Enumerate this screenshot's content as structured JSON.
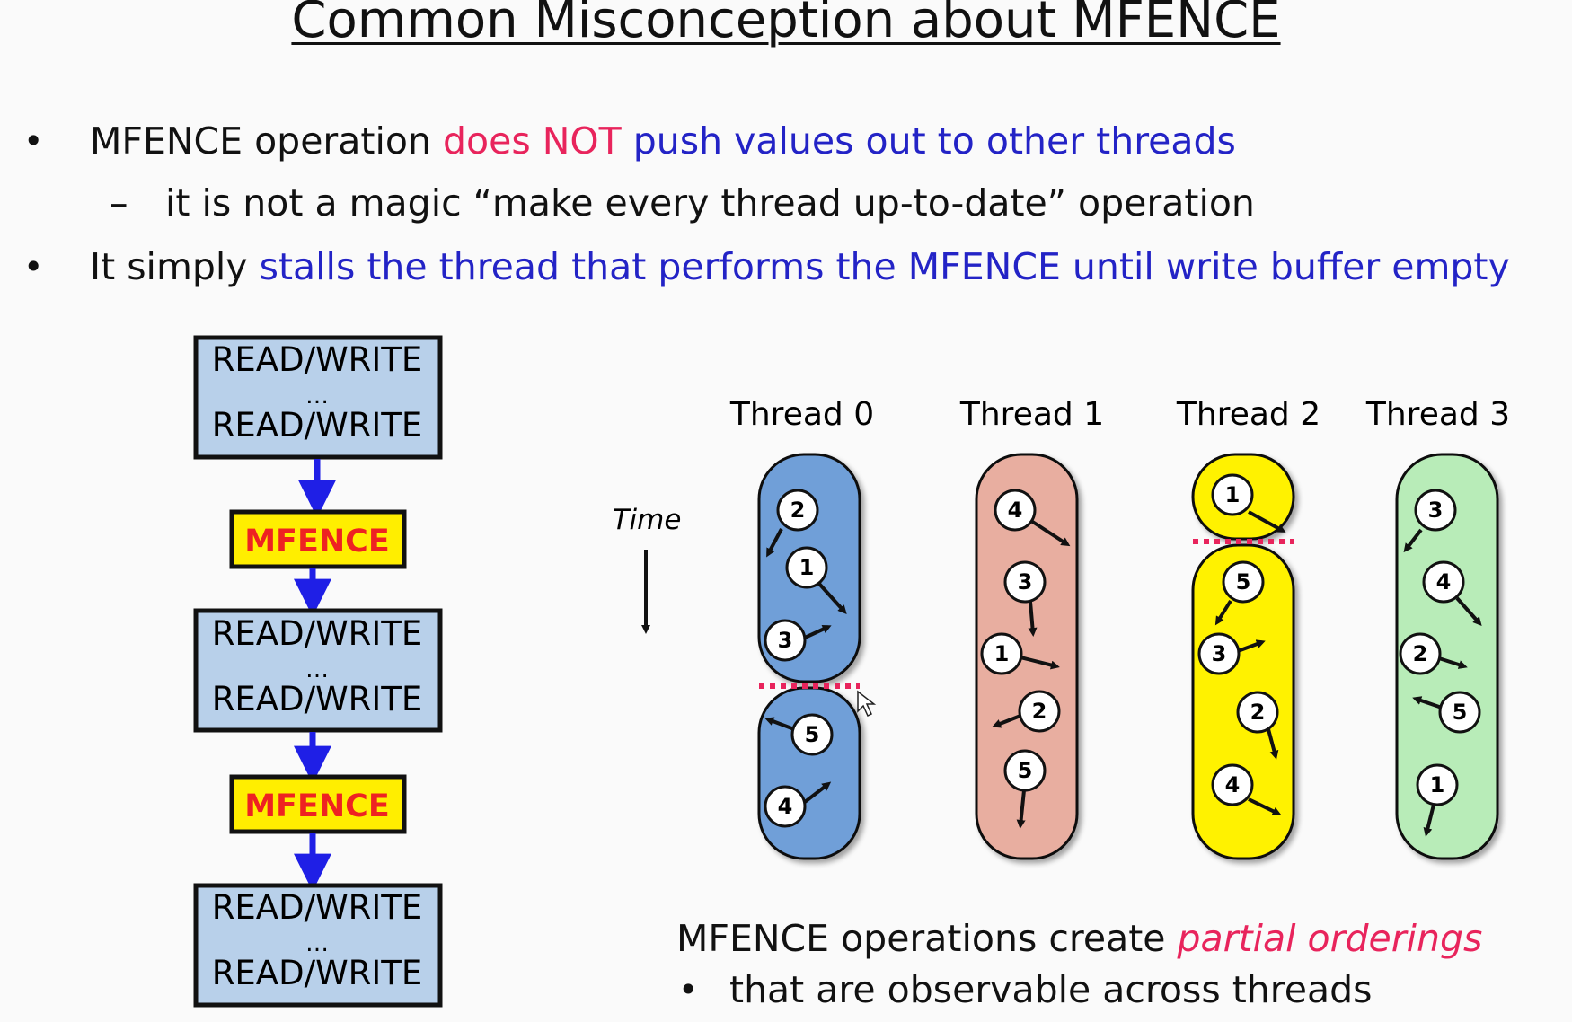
{
  "title": "Common Misconception about MFENCE",
  "bullets": {
    "b1": {
      "p1": "MFENCE operation ",
      "p2": "does NOT",
      "p3": " push values out to other threads"
    },
    "sub1": "it is not a magic “make every thread up-to-date” operation",
    "b2": {
      "p1": "It simply ",
      "p2": "stalls the thread that performs the MFENCE until write buffer empty"
    }
  },
  "left_flow": {
    "block_top": "READ/WRITE",
    "block_ellipsis": "…",
    "block_bottom": "READ/WRITE",
    "fence_label": "MFENCE"
  },
  "threads": {
    "time_label": "Time",
    "labels": [
      "Thread 0",
      "Thread 1",
      "Thread 2",
      "Thread 3"
    ],
    "thread0": {
      "upper": [
        "2",
        "1",
        "3"
      ],
      "lower": [
        "5",
        "4"
      ]
    },
    "thread1": [
      "4",
      "3",
      "1",
      "2",
      "5"
    ],
    "thread2": {
      "upper": [
        "1"
      ],
      "lower": [
        "5",
        "3",
        "2",
        "4"
      ]
    },
    "thread3": [
      "3",
      "4",
      "2",
      "5",
      "1"
    ]
  },
  "caption": {
    "p1": "MFENCE operations create ",
    "p2": "partial orderings",
    "sub": "that are observable across threads"
  },
  "colors": {
    "red": "#e8245c",
    "blue": "#2323c6",
    "block_fill": "#b8d0ea",
    "fence_fill": "#ffee00",
    "fence_text": "#ee2222",
    "t0": "#6f9fd8",
    "t1": "#e8aea0",
    "t2": "#fff200",
    "t3": "#b8ecb8"
  }
}
